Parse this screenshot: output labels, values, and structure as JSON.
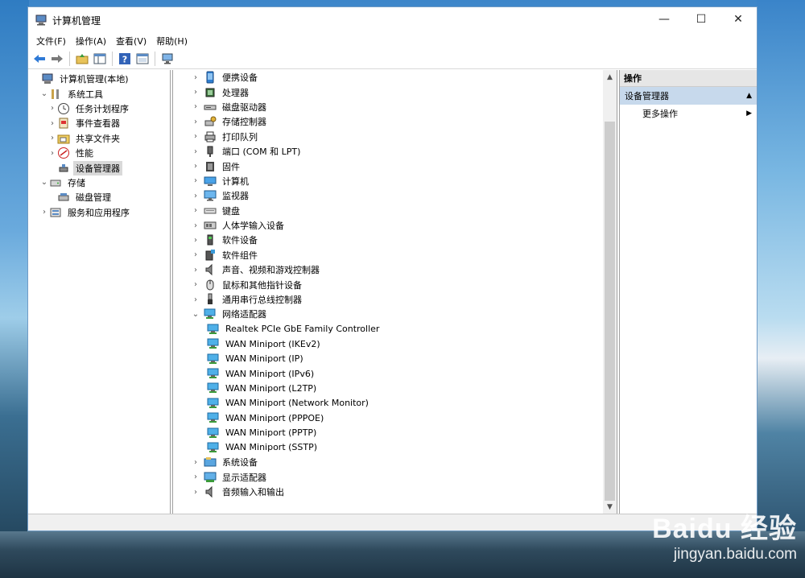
{
  "window": {
    "title": "计算机管理",
    "controls": {
      "minimize": "—",
      "maximize": "☐",
      "close": "✕"
    }
  },
  "menu": [
    "文件(F)",
    "操作(A)",
    "查看(V)",
    "帮助(H)"
  ],
  "toolbar_icons": [
    "back-arrow-icon",
    "forward-arrow-icon",
    "up-folder-icon",
    "show-hide-tree-icon",
    "help-icon",
    "properties-icon",
    "monitor-icon"
  ],
  "left_tree": [
    {
      "label": "计算机管理(本地)",
      "indent": 0,
      "expander": "",
      "icon": "computer-mgmt-icon"
    },
    {
      "label": "系统工具",
      "indent": 1,
      "expander": "⌄",
      "icon": "tools-icon"
    },
    {
      "label": "任务计划程序",
      "indent": 2,
      "expander": "›",
      "icon": "clock-icon"
    },
    {
      "label": "事件查看器",
      "indent": 2,
      "expander": "›",
      "icon": "event-viewer-icon"
    },
    {
      "label": "共享文件夹",
      "indent": 2,
      "expander": "›",
      "icon": "shared-folder-icon"
    },
    {
      "label": "性能",
      "indent": 2,
      "expander": "›",
      "icon": "performance-icon"
    },
    {
      "label": "设备管理器",
      "indent": 2,
      "expander": "",
      "icon": "device-manager-icon",
      "selected": true
    },
    {
      "label": "存储",
      "indent": 1,
      "expander": "⌄",
      "icon": "storage-icon"
    },
    {
      "label": "磁盘管理",
      "indent": 2,
      "expander": "",
      "icon": "disk-mgmt-icon"
    },
    {
      "label": "服务和应用程序",
      "indent": 1,
      "expander": "›",
      "icon": "services-icon"
    }
  ],
  "device_tree": [
    {
      "label": "便携设备",
      "expander": "›",
      "icon": "portable-device-icon"
    },
    {
      "label": "处理器",
      "expander": "›",
      "icon": "processor-icon"
    },
    {
      "label": "磁盘驱动器",
      "expander": "›",
      "icon": "disk-drive-icon"
    },
    {
      "label": "存储控制器",
      "expander": "›",
      "icon": "storage-controller-icon"
    },
    {
      "label": "打印队列",
      "expander": "›",
      "icon": "printer-icon"
    },
    {
      "label": "端口 (COM 和 LPT)",
      "expander": "›",
      "icon": "port-icon"
    },
    {
      "label": "固件",
      "expander": "›",
      "icon": "firmware-icon"
    },
    {
      "label": "计算机",
      "expander": "›",
      "icon": "computer-icon"
    },
    {
      "label": "监视器",
      "expander": "›",
      "icon": "monitor-icon"
    },
    {
      "label": "键盘",
      "expander": "›",
      "icon": "keyboard-icon"
    },
    {
      "label": "人体学输入设备",
      "expander": "›",
      "icon": "hid-icon"
    },
    {
      "label": "软件设备",
      "expander": "›",
      "icon": "software-device-icon"
    },
    {
      "label": "软件组件",
      "expander": "›",
      "icon": "software-component-icon"
    },
    {
      "label": "声音、视频和游戏控制器",
      "expander": "›",
      "icon": "speaker-icon"
    },
    {
      "label": "鼠标和其他指针设备",
      "expander": "›",
      "icon": "mouse-icon"
    },
    {
      "label": "通用串行总线控制器",
      "expander": "›",
      "icon": "usb-icon"
    },
    {
      "label": "网络适配器",
      "expander": "⌄",
      "icon": "network-adapter-icon"
    },
    {
      "label": "Realtek PCIe GbE Family Controller",
      "expander": "",
      "icon": "network-adapter-icon",
      "child": true
    },
    {
      "label": "WAN Miniport (IKEv2)",
      "expander": "",
      "icon": "network-adapter-icon",
      "child": true
    },
    {
      "label": "WAN Miniport (IP)",
      "expander": "",
      "icon": "network-adapter-icon",
      "child": true
    },
    {
      "label": "WAN Miniport (IPv6)",
      "expander": "",
      "icon": "network-adapter-icon",
      "child": true
    },
    {
      "label": "WAN Miniport (L2TP)",
      "expander": "",
      "icon": "network-adapter-icon",
      "child": true
    },
    {
      "label": "WAN Miniport (Network Monitor)",
      "expander": "",
      "icon": "network-adapter-icon",
      "child": true
    },
    {
      "label": "WAN Miniport (PPPOE)",
      "expander": "",
      "icon": "network-adapter-icon",
      "child": true
    },
    {
      "label": "WAN Miniport (PPTP)",
      "expander": "",
      "icon": "network-adapter-icon",
      "child": true
    },
    {
      "label": "WAN Miniport (SSTP)",
      "expander": "",
      "icon": "network-adapter-icon",
      "child": true
    },
    {
      "label": "系统设备",
      "expander": "›",
      "icon": "system-device-icon"
    },
    {
      "label": "显示适配器",
      "expander": "›",
      "icon": "display-adapter-icon"
    },
    {
      "label": "音频输入和输出",
      "expander": "›",
      "icon": "audio-io-icon"
    }
  ],
  "actions": {
    "header": "操作",
    "section": "设备管理器",
    "section_toggle": "▲",
    "more": "更多操作",
    "more_arrow": "▶"
  },
  "scrollbar": {
    "up": "▲",
    "down": "▼"
  },
  "watermark": {
    "logo": "Baidu 经验",
    "url": "jingyan.baidu.com"
  }
}
